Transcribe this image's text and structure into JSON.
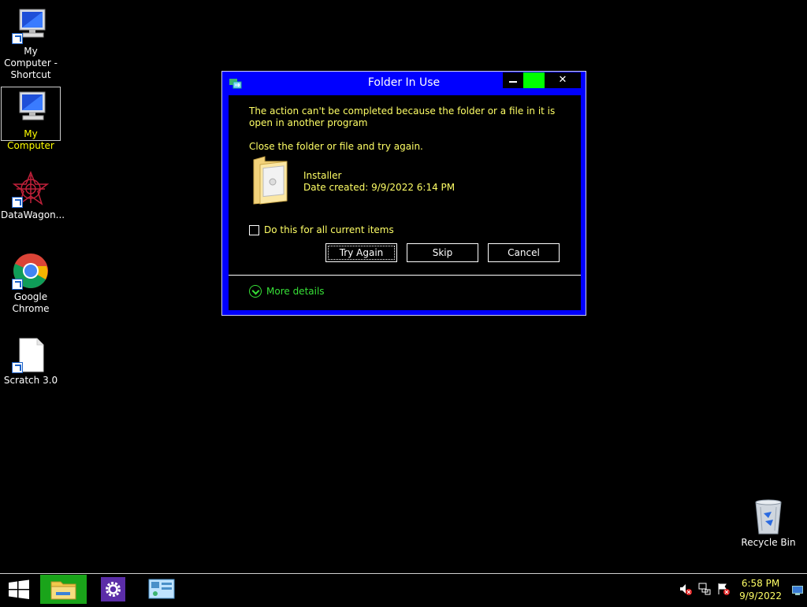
{
  "desktop": {
    "icons": [
      {
        "label": "My Computer - Shortcut",
        "icon": "computer-icon"
      },
      {
        "label": "My Computer",
        "icon": "computer-icon"
      },
      {
        "label": "DataWagon...",
        "icon": "datawagon-icon"
      },
      {
        "label": "Google Chrome",
        "icon": "chrome-icon"
      },
      {
        "label": "Scratch 3.0",
        "icon": "document-icon"
      },
      {
        "label": "Recycle Bin",
        "icon": "recycle-bin-icon"
      }
    ]
  },
  "dialog": {
    "title": "Folder In Use",
    "message": "The action can't be completed because the folder or a file in it is open in another program",
    "instruction": "Close the folder or file and try again.",
    "file_name": "Installer",
    "file_date": "Date created: 9/9/2022 6:14 PM",
    "checkbox_label": "Do this for all current items",
    "buttons": {
      "try_again": "Try Again",
      "skip": "Skip",
      "cancel": "Cancel"
    },
    "more_details": "More details",
    "close_glyph": "✕"
  },
  "taskbar": {
    "time": "6:58 PM",
    "date": "9/9/2022"
  },
  "colors": {
    "dialog_border": "#0000ff",
    "text_yellow": "#ffff66",
    "maximize": "#00ff00",
    "more_details_green": "#37e037"
  }
}
